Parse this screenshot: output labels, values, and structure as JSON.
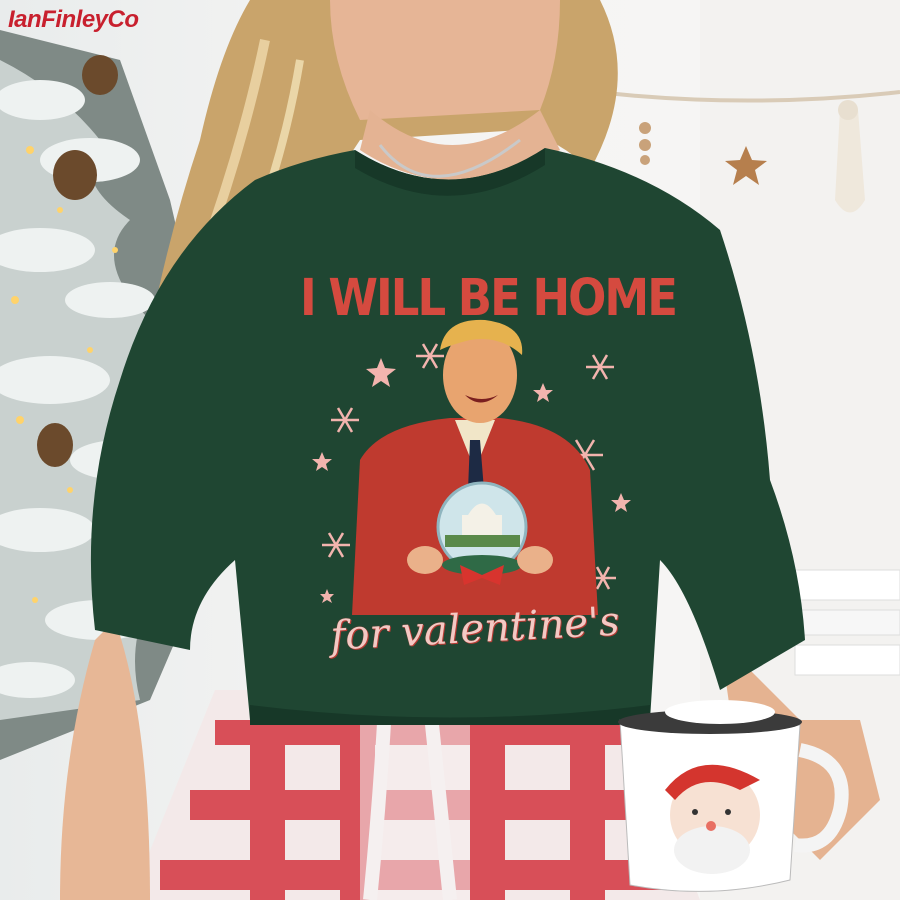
{
  "watermark": "IanFinleyCo",
  "shirt": {
    "headline": "I WILL BE HOME",
    "script_line": "for valentine's",
    "garment_color": "#1f4632",
    "print_red": "#d54a3f",
    "print_pink": "#f3c9c4"
  },
  "props": {
    "mug": "santa-mug",
    "tree": "snowy-christmas-tree",
    "garland": "wooden-star-garland",
    "pajamas": "red-white-plaid"
  }
}
